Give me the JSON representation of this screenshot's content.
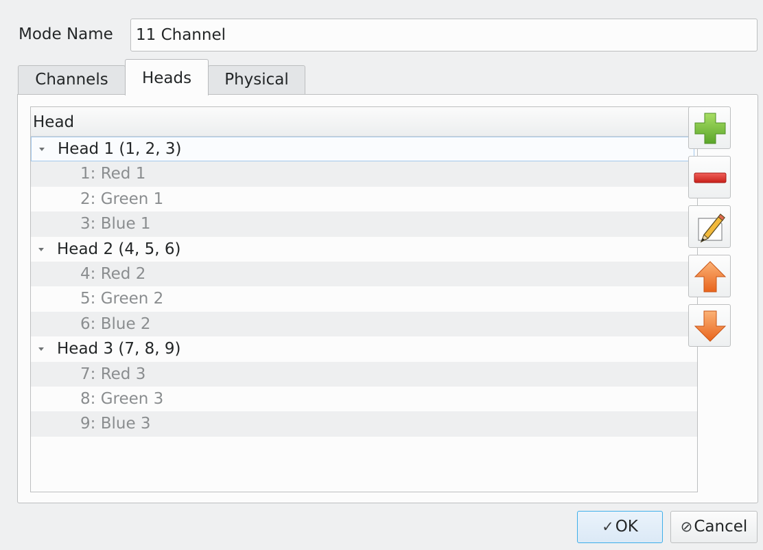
{
  "mode_name": {
    "label": "Mode Name",
    "value": "11 Channel"
  },
  "tabs": [
    {
      "label": "Channels",
      "active": false
    },
    {
      "label": "Heads",
      "active": true
    },
    {
      "label": "Physical",
      "active": false
    }
  ],
  "tree": {
    "header": "Head",
    "groups": [
      {
        "label": "Head 1 (1, 2, 3)",
        "expanded": true,
        "selected": true,
        "children": [
          "1: Red 1",
          "2: Green 1",
          "3: Blue 1"
        ]
      },
      {
        "label": "Head 2 (4, 5, 6)",
        "expanded": true,
        "selected": false,
        "children": [
          "4: Red 2",
          "5: Green 2",
          "6: Blue 2"
        ]
      },
      {
        "label": "Head 3 (7, 8, 9)",
        "expanded": true,
        "selected": false,
        "children": [
          "7: Red 3",
          "8: Green 3",
          "9: Blue 3"
        ]
      }
    ]
  },
  "side_buttons": {
    "add_icon": "plus-icon",
    "remove_icon": "minus-icon",
    "edit_icon": "pencil-icon",
    "up_icon": "arrow-up-icon",
    "down_icon": "arrow-down-icon"
  },
  "dialog_buttons": {
    "ok_glyph": "✓",
    "ok_label": "OK",
    "cancel_glyph": "⊘",
    "cancel_label": "Cancel"
  },
  "colors": {
    "accent": "#3daee9",
    "add_green": "#7cc242",
    "remove_red": "#e0342c",
    "arrow_orange": "#f07b2c"
  }
}
